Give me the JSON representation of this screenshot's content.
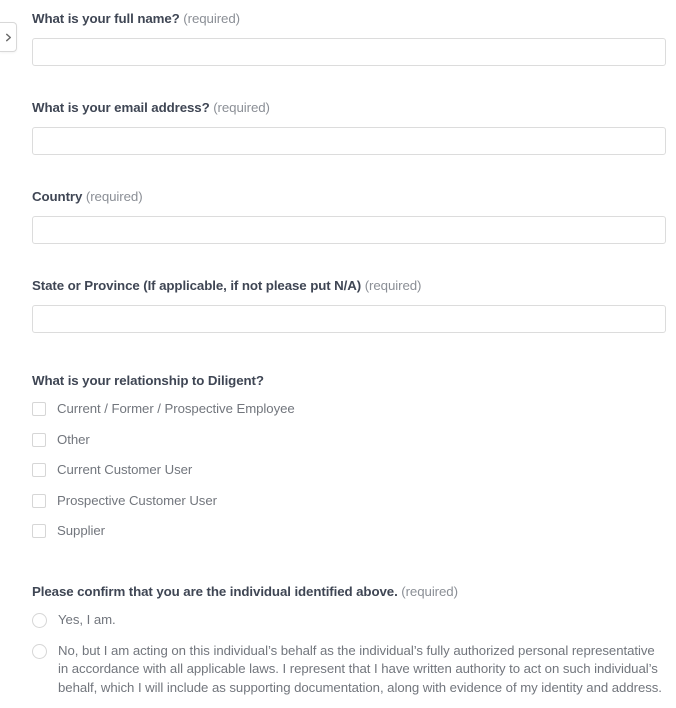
{
  "sidebar_toggle": {
    "icon": "chevron-right-icon",
    "aria_label": "Expand sidebar"
  },
  "theme": {
    "label_color": "#3f4654",
    "required_color": "#8b8f96",
    "option_text_color": "#72767d",
    "input_border_color": "#dcdcdc",
    "control_border_color": "#d6d6d6",
    "background": "#ffffff"
  },
  "required_suffix": "(required)",
  "form": {
    "fields": [
      {
        "id": "full-name",
        "type": "text",
        "label": "What is your full name?",
        "required_text": "(required)",
        "value": "",
        "placeholder": ""
      },
      {
        "id": "email-address",
        "type": "text",
        "label": "What is your email address?",
        "required_text": "(required)",
        "value": "",
        "placeholder": ""
      },
      {
        "id": "country",
        "type": "text",
        "label": "Country",
        "required_text": "(required)",
        "value": "",
        "placeholder": ""
      },
      {
        "id": "state-or-province",
        "type": "text",
        "label": "State or Province (If applicable, if not please put N/A)",
        "required_text": "(required)",
        "value": "",
        "placeholder": ""
      },
      {
        "id": "relationship",
        "type": "checkbox-group",
        "label": "What is your relationship to Diligent?",
        "required_text": "",
        "options": [
          {
            "label": "Current / Former / Prospective Employee",
            "checked": false
          },
          {
            "label": "Other",
            "checked": false
          },
          {
            "label": "Current Customer User",
            "checked": false
          },
          {
            "label": "Prospective Customer User",
            "checked": false
          },
          {
            "label": "Supplier",
            "checked": false
          }
        ]
      },
      {
        "id": "confirm-identity",
        "type": "radio-group",
        "label": "Please confirm that you are the individual identified above.",
        "required_text": "(required)",
        "options": [
          {
            "label": "Yes, I am.",
            "selected": false
          },
          {
            "label": "No, but I am acting on this individual’s behalf as the individual’s fully authorized personal representative in accordance with all applicable laws. I represent that I have written authority to act on such individual’s behalf, which I will include as supporting documentation, along with evidence of my identity and address.",
            "selected": false
          }
        ]
      }
    ]
  }
}
